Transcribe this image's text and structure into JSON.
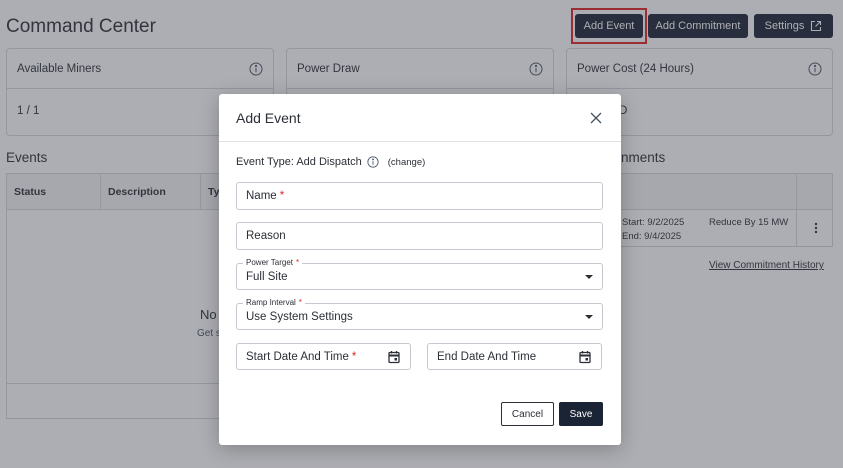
{
  "page": {
    "title": "Command Center",
    "actions": {
      "add_event": "Add Event",
      "add_commitment": "Add Commitment",
      "settings": "Settings"
    }
  },
  "cards": [
    {
      "title": "Available Miners",
      "value": "1 / 1"
    },
    {
      "title": "Power Draw",
      "value": ""
    },
    {
      "title": "Power Cost (24 Hours)",
      "value": "D"
    }
  ],
  "events": {
    "title": "Events",
    "columns": [
      "Status",
      "Description",
      "Ty"
    ],
    "empty_title": "No",
    "empty_sub": "Get s"
  },
  "commitments": {
    "title": "nments",
    "row": {
      "start": "Start: 9/2/2025",
      "end": "End: 9/4/2025",
      "reduce": "Reduce By 15 MW"
    },
    "history_link": "View Commitment History"
  },
  "modal": {
    "title": "Add Event",
    "event_type": "Event Type: Add Dispatch",
    "change": "(change)",
    "name_placeholder": "Name",
    "reason_placeholder": "Reason",
    "power_target": {
      "label": "Power Target",
      "value": "Full Site"
    },
    "ramp_interval": {
      "label": "Ramp Interval",
      "value": "Use System Settings"
    },
    "start_date": "Start Date And Time",
    "end_date": "End Date And Time",
    "required_mark": "*",
    "cancel": "Cancel",
    "save": "Save"
  },
  "colors": {
    "primary": "#1b2434",
    "required": "#dc2626",
    "highlight": "#e02424",
    "overlay": "#3c3e4a"
  }
}
